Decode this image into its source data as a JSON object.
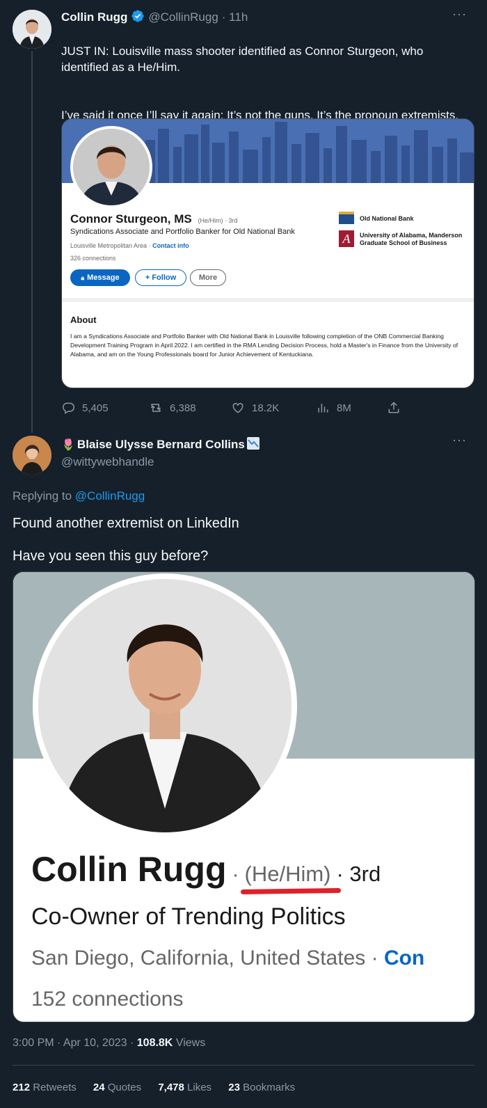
{
  "tweet1": {
    "display_name": "Collin Rugg",
    "handle": "@CollinRugg",
    "time": "· 11h",
    "text_line1": "JUST IN: Louisville mass shooter identified as Connor Sturgeon, who identified as a He/Him.",
    "text_line2": "I’ve said it once I’ll say it again: It’s not the guns. It’s the pronoun extremists.",
    "more": "···",
    "card": {
      "name": "Connor Sturgeon, MS",
      "pronouns": "(He/Him) · 3rd",
      "headline": "Syndications Associate and Portfolio Banker for Old National Bank",
      "location": "Louisville Metropolitan Area ·",
      "contact": "Contact info",
      "connections": "326 connections",
      "btn_message": "Message",
      "btn_follow": "+ Follow",
      "btn_more": "More",
      "company1": "Old National Bank",
      "company2": "University of Alabama, Manderson Graduate School of Business",
      "about_title": "About",
      "about_text": "I am a Syndications Associate and Portfolio Banker with Old National Bank in Louisville following completion of the ONB Commercial Banking Development Training Program in April 2022. I am certified in the RMA Lending Decision Process, hold a Master's in Finance from the University of Alabama, and am on the Young Professionals board for Junior Achievement of Kentuckiana.",
      "colors": {
        "banner": "#3f64a8",
        "message_btn": "#0a66c2"
      }
    },
    "actions": {
      "replies": "5,405",
      "retweets": "6,388",
      "likes": "18.2K",
      "views": "8M"
    }
  },
  "tweet2": {
    "display_name": "Blaise Ulysse Bernard Collins",
    "handle": "@wittywebhandle",
    "more": "···",
    "replying_prefix": "Replying to",
    "replying_handle": "@CollinRugg",
    "text_line1": "Found another extremist on LinkedIn",
    "text_line2": "Have you seen this guy before?",
    "card": {
      "name": "Collin Rugg",
      "dot1": "·",
      "pronouns": "(He/Him)",
      "dot2": "· 3rd",
      "headline": "Co-Owner of Trending Politics",
      "location": "San Diego, California, United States · ",
      "contact_partial": "Con",
      "connections": "152 connections",
      "colors": {
        "banner": "#a7b6b9",
        "underline": "#e0202a"
      }
    },
    "timestamp": "3:00 PM · Apr 10, 2023 · ",
    "views_count": "108.8K",
    "views_label": "Views",
    "stats": {
      "retweets_count": "212",
      "retweets_label": "Retweets",
      "quotes_count": "24",
      "quotes_label": "Quotes",
      "likes_count": "7,478",
      "likes_label": "Likes",
      "bookmarks_count": "23",
      "bookmarks_label": "Bookmarks"
    }
  },
  "icons": {
    "verified": "verified-badge-icon",
    "reply": "reply-icon",
    "retweet": "retweet-icon",
    "like": "heart-icon",
    "views": "views-bar-icon",
    "share": "share-icon",
    "tulip": "tulip-icon",
    "chart_emoji": "chart-decreasing-icon"
  },
  "colors": {
    "background": "#15202b",
    "link": "#1d9bf0",
    "muted": "#8b98a5"
  }
}
